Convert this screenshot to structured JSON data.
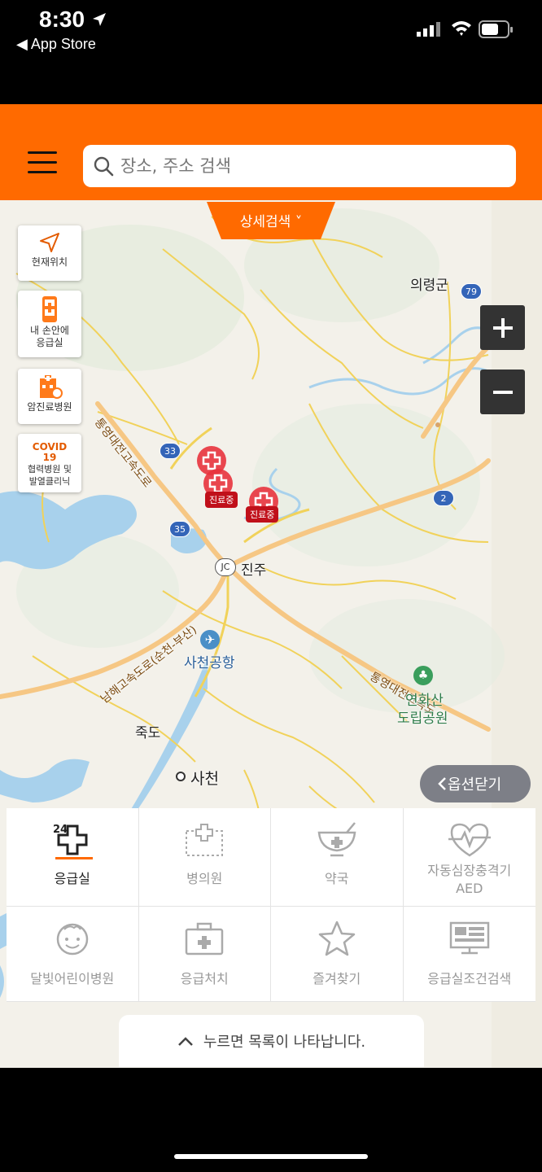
{
  "status_bar": {
    "time": "8:30",
    "back_label": "◀ App Store"
  },
  "search": {
    "placeholder": "장소, 주소 검색"
  },
  "detail_search": {
    "label": "상세검색 ˅"
  },
  "side_buttons": {
    "current_location": "현재위치",
    "my_hand_er_line1": "내 손안에",
    "my_hand_er_line2": "응급실",
    "cancer_hospital": "암진료병원",
    "covid_title_1": "COVID",
    "covid_title_2": "19",
    "covid_line1": "협력병원 및",
    "covid_line2": "발열클리닉"
  },
  "zoom": {
    "plus": "+",
    "minus": "−"
  },
  "map_labels": {
    "uiryeong": "의령군",
    "jinju": "진주",
    "jc": "JC",
    "sacheon_airport": "사천공항",
    "jukdo": "죽도",
    "sacheon": "사천",
    "yeonhwasan_1": "연화산",
    "yeonhwasan_2": "도립공원",
    "tongyeong_hwy_1": "통영대전고속도로",
    "tongyeong_hwy_2": "통영대전고속도",
    "namhae_hwy": "남해고속도로(순천-부산)",
    "route_33": "33",
    "route_35": "35",
    "route_79": "79",
    "route_2": "2"
  },
  "markers": {
    "in_treatment": "진료중"
  },
  "close_options": {
    "label": "옵션닫기"
  },
  "categories": [
    {
      "label": "응급실",
      "badge": "24"
    },
    {
      "label": "병의원"
    },
    {
      "label": "약국"
    },
    {
      "label": "자동심장충격기",
      "label2": "AED"
    },
    {
      "label": "달빛어린이병원"
    },
    {
      "label": "응급처치"
    },
    {
      "label": "즐겨찾기"
    },
    {
      "label": "응급실조건검색"
    }
  ],
  "drawer": {
    "label": "누르면 목록이 나타납니다."
  },
  "colors": {
    "brand": "#ff6a00",
    "marker": "#e8333d",
    "badge": "#c0101a",
    "inactive": "#999999"
  }
}
